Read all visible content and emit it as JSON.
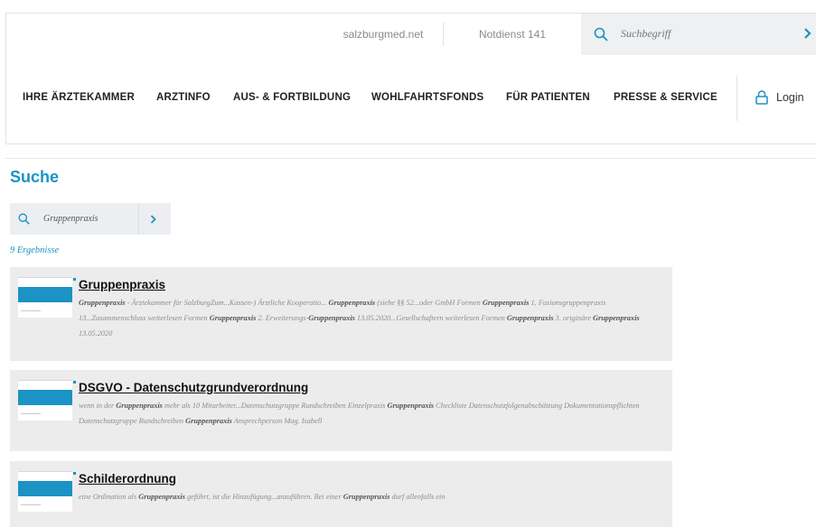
{
  "topbar": {
    "site_link": "salzburgmed.net",
    "notdienst": "Notdienst 141",
    "search_placeholder": "Suchbegriff"
  },
  "nav": {
    "items": [
      "IHRE ÄRZTEKAMMER",
      "ARZTINFO",
      "AUS- & FORTBILDUNG",
      "WOHLFAHRTSFONDS",
      "FÜR PATIENTEN",
      "PRESSE & SERVICE"
    ],
    "login_label": "Login"
  },
  "main": {
    "title": "Suche",
    "search_value": "Gruppenpraxis",
    "result_count": "9 Ergebnisse"
  },
  "results": [
    {
      "title": "Gruppenpraxis",
      "snippet": [
        {
          "b": "Gruppenpraxis"
        },
        {
          "t": " - Ärztekammer für SalzburgZum...Kassen-) Ärztliche Kooperatio... "
        },
        {
          "b": "Gruppenpraxis"
        },
        {
          "t": " (siehe §§ 52...oder GmbH Formen "
        },
        {
          "b": "Gruppenpraxis"
        },
        {
          "t": " 1. Fusionsgruppenpraxis 13...Zusammenschluss weiterlesen Formen "
        },
        {
          "b": "Gruppenpraxis"
        },
        {
          "t": " 2. Erweiterungs-"
        },
        {
          "b": "Gruppenpraxis"
        },
        {
          "t": " 13.05.2020...Gesellschaftern weiterlesen Formen "
        },
        {
          "b": "Gruppenpraxis"
        },
        {
          "t": " 3. originäre "
        },
        {
          "b": "Gruppenpraxis"
        },
        {
          "t": " 13.05.2020"
        }
      ]
    },
    {
      "title": "DSGVO - Datenschutzgrundverordnung",
      "snippet": [
        {
          "t": "wenn in der "
        },
        {
          "b": "Gruppenpraxis"
        },
        {
          "t": " mehr als 10 Mitarbeiter...Datenschutzgruppe Rundschreiben Einzelpraxis "
        },
        {
          "b": "Gruppenpraxis"
        },
        {
          "t": " Checkliste Datenschutzfolgenabschätzung Dokumentationspflichten Datenschutzgruppe Rundschreiben "
        },
        {
          "b": "Gruppenpraxis"
        },
        {
          "t": " Ansprechperson Mag. Isabell"
        }
      ]
    },
    {
      "title": "Schilderordnung",
      "snippet": [
        {
          "t": "eine Ordination als "
        },
        {
          "b": "Gruppenpraxis"
        },
        {
          "t": " geführt, ist die Hinzufügung...anzuführen. Bei einer "
        },
        {
          "b": "Gruppenpraxis"
        },
        {
          "t": " darf allenfalls ein"
        }
      ]
    }
  ],
  "colors": {
    "accent": "#1b93c4",
    "card_bg": "#ececec",
    "search_bg": "#eef0f2"
  }
}
